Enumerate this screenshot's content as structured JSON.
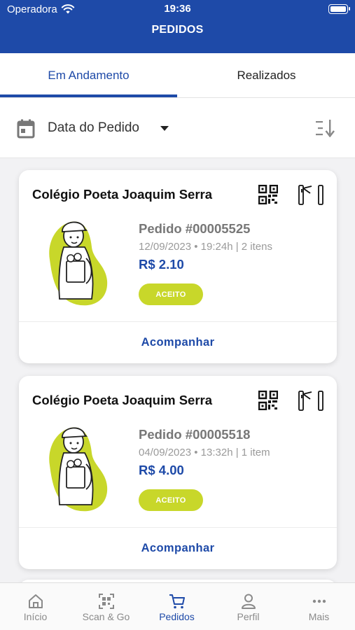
{
  "status_bar": {
    "carrier": "Operadora",
    "time": "19:36"
  },
  "header": {
    "title": "PEDIDOS"
  },
  "tabs": [
    {
      "label": "Em Andamento",
      "active": true
    },
    {
      "label": "Realizados",
      "active": false
    }
  ],
  "filter": {
    "label": "Data do Pedido",
    "icon": "calendar-icon",
    "sort_icon": "sort-icon"
  },
  "orders": [
    {
      "school": "Colégio Poeta Joaquim Serra",
      "number": "Pedido #00005525",
      "meta": "12/09/2023 • 19:24h | 2 itens",
      "price": "R$ 2.10",
      "status": "ACEITO",
      "action": "Acompanhar"
    },
    {
      "school": "Colégio Poeta Joaquim Serra",
      "number": "Pedido #00005518",
      "meta": "04/09/2023 • 13:32h | 1 item",
      "price": "R$ 4.00",
      "status": "ACEITO",
      "action": "Acompanhar"
    }
  ],
  "tabbar": [
    {
      "label": "Início",
      "icon": "home-icon",
      "active": false
    },
    {
      "label": "Scan & Go",
      "icon": "scan-icon",
      "active": false
    },
    {
      "label": "Pedidos",
      "icon": "cart-icon",
      "active": true
    },
    {
      "label": "Perfil",
      "icon": "profile-icon",
      "active": false
    },
    {
      "label": "Mais",
      "icon": "more-icon",
      "active": false
    }
  ],
  "colors": {
    "primary": "#1e4aa8",
    "badge": "#c8d72a",
    "illustration_blob": "#c8d72a"
  }
}
